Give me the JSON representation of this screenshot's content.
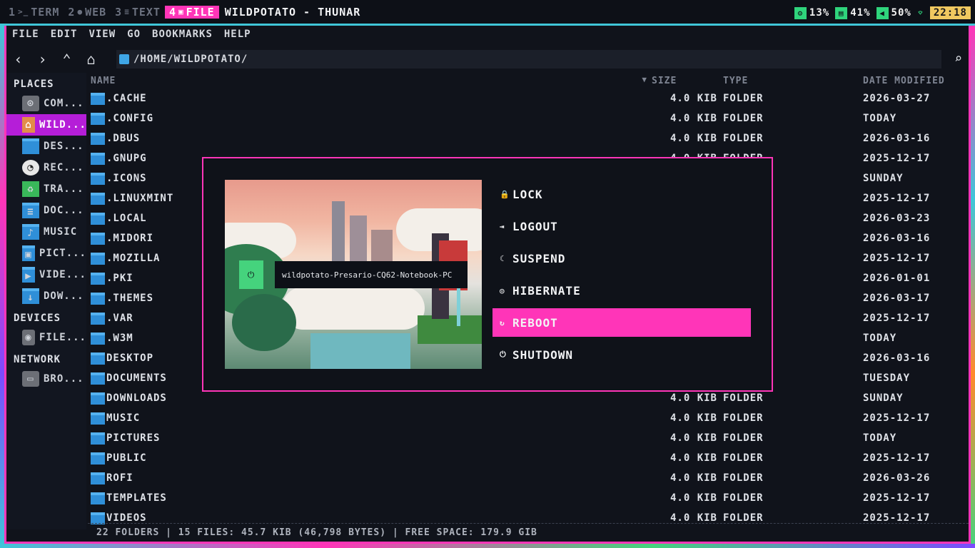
{
  "topbar": {
    "workspaces": [
      {
        "num": "1",
        "icon": ">_",
        "label": "TERM",
        "active": false
      },
      {
        "num": "2",
        "icon": "●",
        "label": "WEB",
        "active": false
      },
      {
        "num": "3",
        "icon": "≡",
        "label": "TEXT",
        "active": false
      },
      {
        "num": "4",
        "icon": "▣",
        "label": "FILE",
        "active": true
      }
    ],
    "window_title": "WILDPOTATO - THUNAR",
    "tray": {
      "cpu": "13%",
      "ram": "41%",
      "volume": "50%",
      "clock": "22:18"
    }
  },
  "menubar": [
    "FILE",
    "EDIT",
    "VIEW",
    "GO",
    "BOOKMARKS",
    "HELP"
  ],
  "toolbar": {
    "path": "/home/wildpotato/"
  },
  "sidebar": {
    "places_header": "PLACES",
    "places": [
      {
        "label": "COM...",
        "icon": "computer-icon"
      },
      {
        "label": "WILD...",
        "icon": "home-icon"
      },
      {
        "label": "DES...",
        "icon": "desktop-icon"
      },
      {
        "label": "REC...",
        "icon": "recent-icon"
      },
      {
        "label": "TRA...",
        "icon": "trash-icon"
      },
      {
        "label": "DOC...",
        "icon": "documents-icon"
      },
      {
        "label": "MUSIC",
        "icon": "music-icon"
      },
      {
        "label": "PICT...",
        "icon": "pictures-icon"
      },
      {
        "label": "VIDE...",
        "icon": "videos-icon"
      },
      {
        "label": "DOW...",
        "icon": "downloads-icon"
      }
    ],
    "devices_header": "DEVICES",
    "devices": [
      {
        "label": "FILE...",
        "icon": "filesystem-icon"
      }
    ],
    "network_header": "NETWORK",
    "network": [
      {
        "label": "BRO...",
        "icon": "network-icon"
      }
    ]
  },
  "columns": {
    "name": "NAME",
    "size": "SIZE",
    "type": "TYPE",
    "date": "DATE MODIFIED"
  },
  "files": [
    {
      "name": ".CACHE",
      "size": "4.0 KIB",
      "type": "FOLDER",
      "date": "2026-03-27"
    },
    {
      "name": ".CONFIG",
      "size": "4.0 KIB",
      "type": "FOLDER",
      "date": "TODAY"
    },
    {
      "name": ".DBUS",
      "size": "4.0 KIB",
      "type": "FOLDER",
      "date": "2026-03-16"
    },
    {
      "name": ".GNUPG",
      "size": "4.0 KIB",
      "type": "FOLDER",
      "date": "2025-12-17"
    },
    {
      "name": ".ICONS",
      "size": "",
      "type": "",
      "date": "SUNDAY"
    },
    {
      "name": ".LINUXMINT",
      "size": "",
      "type": "",
      "date": "2025-12-17"
    },
    {
      "name": ".LOCAL",
      "size": "",
      "type": "",
      "date": "2026-03-23"
    },
    {
      "name": ".MIDORI",
      "size": "",
      "type": "",
      "date": "2026-03-16"
    },
    {
      "name": ".MOZILLA",
      "size": "",
      "type": "",
      "date": "2025-12-17"
    },
    {
      "name": ".PKI",
      "size": "",
      "type": "",
      "date": "2026-01-01"
    },
    {
      "name": ".THEMES",
      "size": "",
      "type": "",
      "date": "2026-03-17"
    },
    {
      "name": ".VAR",
      "size": "",
      "type": "",
      "date": "2025-12-17"
    },
    {
      "name": ".W3M",
      "size": "",
      "type": "",
      "date": "TODAY"
    },
    {
      "name": "DESKTOP",
      "size": "",
      "type": "",
      "date": "2026-03-16"
    },
    {
      "name": "DOCUMENTS",
      "size": "",
      "type": "",
      "date": "TUESDAY"
    },
    {
      "name": "DOWNLOADS",
      "size": "4.0 KIB",
      "type": "FOLDER",
      "date": "SUNDAY"
    },
    {
      "name": "MUSIC",
      "size": "4.0 KIB",
      "type": "FOLDER",
      "date": "2025-12-17"
    },
    {
      "name": "PICTURES",
      "size": "4.0 KIB",
      "type": "FOLDER",
      "date": "TODAY"
    },
    {
      "name": "PUBLIC",
      "size": "4.0 KIB",
      "type": "FOLDER",
      "date": "2025-12-17"
    },
    {
      "name": "ROFI",
      "size": "4.0 KIB",
      "type": "FOLDER",
      "date": "2026-03-26"
    },
    {
      "name": "TEMPLATES",
      "size": "4.0 KIB",
      "type": "FOLDER",
      "date": "2025-12-17"
    },
    {
      "name": "VIDEOS",
      "size": "4.0 KIB",
      "type": "FOLDER",
      "date": "2025-12-17"
    }
  ],
  "statusbar": "22 FOLDERS | 15 FILES: 45.7 KIB (46,798 BYTES) | FREE SPACE: 179.9 GIB",
  "power_dialog": {
    "hostname": "wildpotato-Presario-CQ62-Notebook-PC",
    "options": [
      {
        "icon": "🔒",
        "label": "LOCK",
        "active": false
      },
      {
        "icon": "⇥",
        "label": "LOGOUT",
        "active": false
      },
      {
        "icon": "☾",
        "label": "SUSPEND",
        "active": false
      },
      {
        "icon": "◎",
        "label": "HIBERNATE",
        "active": false
      },
      {
        "icon": "↻",
        "label": "REBOOT",
        "active": true
      },
      {
        "icon": "⏻",
        "label": "SHUTDOWN",
        "active": false
      }
    ]
  },
  "colors": {
    "accent": "#ff35b8",
    "green": "#45d37d",
    "cyan": "#3fc6d8",
    "clock": "#f0c860"
  }
}
